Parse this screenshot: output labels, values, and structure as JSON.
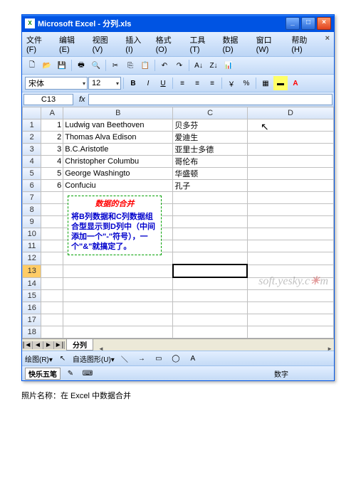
{
  "window": {
    "title": "Microsoft Excel - 分列.xls",
    "min": "_",
    "max": "□",
    "close": "×"
  },
  "menu": {
    "file": "文件(F)",
    "edit": "编辑(E)",
    "view": "视图(V)",
    "insert": "插入(I)",
    "format": "格式(O)",
    "tools": "工具(T)",
    "data": "数据(D)",
    "window": "窗口(W)",
    "help": "帮助(H)",
    "close_doc": "×"
  },
  "fontbar": {
    "font_name": "宋体",
    "font_size": "12",
    "bold": "B",
    "italic": "I",
    "underline": "U"
  },
  "formula": {
    "namebox": "C13",
    "fx": "fx"
  },
  "columns": {
    "rowcorner": "",
    "A": "A",
    "B": "B",
    "C": "C",
    "D": "D"
  },
  "rows": [
    {
      "n": "1",
      "A": "1",
      "B": "Ludwig van Beethoven",
      "C": "贝多芬"
    },
    {
      "n": "2",
      "A": "2",
      "B": "Thomas Alva Edison",
      "C": "爱迪生"
    },
    {
      "n": "3",
      "A": "3",
      "B": "B.C.Aristotle",
      "C": "亚里士多德"
    },
    {
      "n": "4",
      "A": "4",
      "B": "Christopher Columbu",
      "C": "哥伦布"
    },
    {
      "n": "5",
      "A": "5",
      "B": "George Washingto",
      "C": "华盛顿"
    },
    {
      "n": "6",
      "A": "6",
      "B": "Confuciu",
      "C": "孔子"
    },
    {
      "n": "7"
    },
    {
      "n": "8"
    },
    {
      "n": "9"
    },
    {
      "n": "10"
    },
    {
      "n": "11"
    },
    {
      "n": "12"
    },
    {
      "n": "13"
    },
    {
      "n": "14"
    },
    {
      "n": "15"
    },
    {
      "n": "16"
    },
    {
      "n": "17"
    },
    {
      "n": "18"
    }
  ],
  "textbox": {
    "title": "数据的合并",
    "body": "将B列数据和C列数据组合型显示到D列中（中间添加一个\"-\"符号），一个\"&\"就搞定了。"
  },
  "watermark": "soft.yesky.c  m",
  "sheet": {
    "nav1": "|◄",
    "nav2": "◄",
    "nav3": "►",
    "nav4": "►|",
    "tab": "分列"
  },
  "drawbar": {
    "label1": "绘图(R)▾",
    "label2": "自选图形(U)▾"
  },
  "status": {
    "ime": "快乐五笔",
    "numlock": "数字"
  },
  "caption": "照片名称：在 Excel 中数据合并"
}
